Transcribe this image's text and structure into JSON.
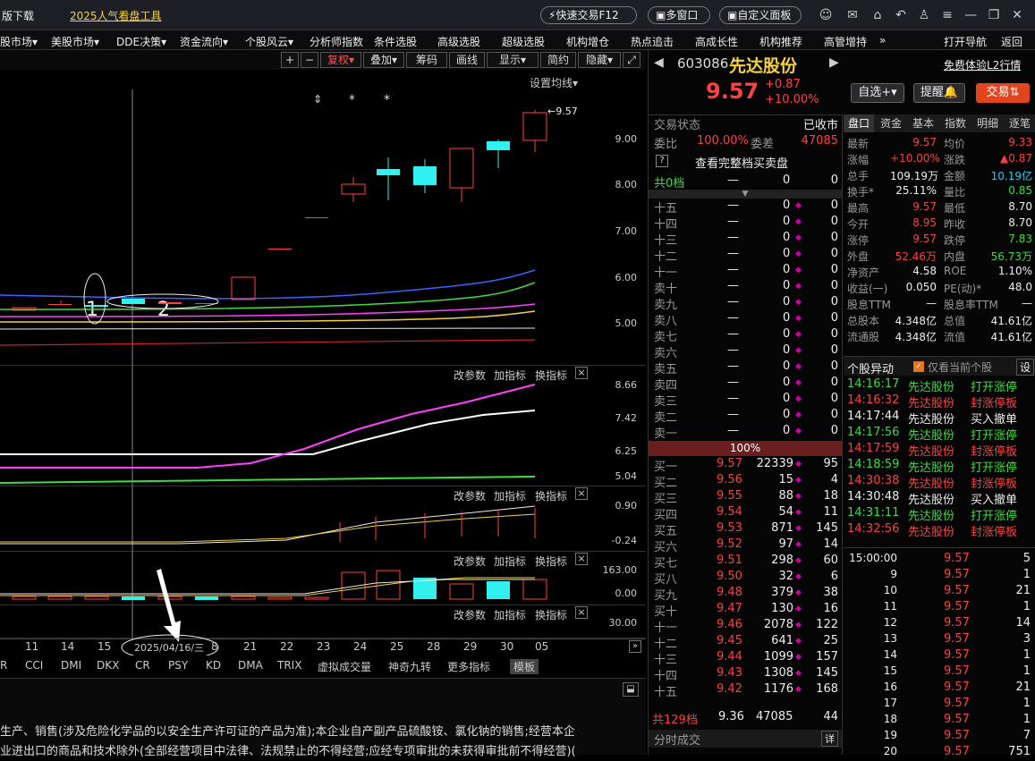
{
  "topbar": {
    "download": "版下载",
    "promo": "2025人气看盘工具",
    "quick_trade": "快速交易F12",
    "multi_window": "多窗口",
    "custom_panel": "自定义面板"
  },
  "menu": [
    "股市场▾",
    "美股市场▾",
    "DDE决策▾",
    "资金流向▾",
    "个股风云▾",
    "分析师指数",
    "条件选股",
    "高级选股",
    "超级选股",
    "机构增仓",
    "热点追击",
    "高成长性",
    "机构推荐",
    "高管增持",
    "»",
    "打开导航",
    "返回"
  ],
  "chart_toolbar": {
    "plus": "+",
    "minus": "−",
    "fuquan": "复权▾",
    "diejia": "叠加▾",
    "chouma": "筹码",
    "huaxian": "画线",
    "xianshi": "显示▾",
    "jianyue": "简约",
    "yincang": "隐藏▾"
  },
  "main_panel": {
    "setting": "设置均线▾",
    "price_label": "9.57",
    "yticks": [
      "9.00",
      "8.00",
      "7.00",
      "6.00",
      "5.00"
    ],
    "annot1": "1",
    "annot2": "2"
  },
  "sub_panels": [
    {
      "ticks": [
        "8.66",
        "7.42",
        "6.25",
        "5.04"
      ]
    },
    {
      "ticks": [
        "0.90",
        "-0.24"
      ]
    },
    {
      "ticks": [
        "163.00",
        "0.00"
      ]
    },
    {
      "ticks": [
        "30.00"
      ]
    }
  ],
  "panel_buttons": {
    "change": "改参数",
    "add": "加指标",
    "switch": "换指标",
    "close": "×"
  },
  "xaxis": {
    "labels": [
      "11",
      "14",
      "15",
      "8",
      "21",
      "22",
      "23",
      "24",
      "25",
      "28",
      "29",
      "30",
      "05"
    ],
    "cursor_date": "2025/04/16/三"
  },
  "indicator_tabs": [
    "R",
    "CCI",
    "DMI",
    "DKX",
    "CR",
    "PSY",
    "KD",
    "DMA",
    "TRIX",
    "虚拟成交量",
    "神奇九转",
    "更多指标",
    "模板"
  ],
  "description": [
    "生产、销售(涉及危险化学品的以安全生产许可证的产品为准);本企业自产副产品硫酸铵、氯化钠的销售;经营本企",
    "业进出口的商品和技术除外(全部经营项目中法律、法规禁止的不得经营;应经专项审批的未获得审批前不得经营)("
  ],
  "stock": {
    "code": "603086",
    "name": "先达股份",
    "price": "9.57",
    "change": "+0.87",
    "pct": "+10.00%",
    "btn_zixuan": "自选+▾",
    "btn_tixing": "提醒",
    "btn_jiaoyi": "交易",
    "l2": "免费体验L2行情"
  },
  "status": {
    "label": "交易状态",
    "value": "已收市",
    "weibi_label": "委比",
    "weibi": "100.00%",
    "weicha_label": "委差",
    "weicha": "47085",
    "view_all": "查看完整档买卖盘",
    "total_label": "共0档",
    "total_dash": "—",
    "total_a": "0",
    "total_b": "0"
  },
  "asks": [
    {
      "l": "十五"
    },
    {
      "l": "十四"
    },
    {
      "l": "十三"
    },
    {
      "l": "十二"
    },
    {
      "l": "十一"
    },
    {
      "l": "卖十"
    },
    {
      "l": "卖九"
    },
    {
      "l": "卖八"
    },
    {
      "l": "卖七"
    },
    {
      "l": "卖六"
    },
    {
      "l": "卖五"
    },
    {
      "l": "卖四"
    },
    {
      "l": "卖三"
    },
    {
      "l": "卖二"
    },
    {
      "l": "卖一"
    }
  ],
  "ask_dash": "—",
  "ask_zero": "0",
  "ratio_bar": "100%",
  "bids": [
    {
      "l": "买一",
      "p": "9.57",
      "v": "22339",
      "c": "95"
    },
    {
      "l": "买二",
      "p": "9.56",
      "v": "15",
      "c": "4"
    },
    {
      "l": "买三",
      "p": "9.55",
      "v": "88",
      "c": "18"
    },
    {
      "l": "买四",
      "p": "9.54",
      "v": "54",
      "c": "11"
    },
    {
      "l": "买五",
      "p": "9.53",
      "v": "871",
      "c": "145"
    },
    {
      "l": "买六",
      "p": "9.52",
      "v": "97",
      "c": "14"
    },
    {
      "l": "买七",
      "p": "9.51",
      "v": "298",
      "c": "60"
    },
    {
      "l": "买八",
      "p": "9.50",
      "v": "32",
      "c": "6"
    },
    {
      "l": "买九",
      "p": "9.48",
      "v": "379",
      "c": "38"
    },
    {
      "l": "买十",
      "p": "9.47",
      "v": "130",
      "c": "16"
    },
    {
      "l": "十一",
      "p": "9.46",
      "v": "2078",
      "c": "122"
    },
    {
      "l": "十二",
      "p": "9.45",
      "v": "641",
      "c": "25"
    },
    {
      "l": "十三",
      "p": "9.44",
      "v": "1099",
      "c": "157"
    },
    {
      "l": "十四",
      "p": "9.43",
      "v": "1308",
      "c": "145"
    },
    {
      "l": "十五",
      "p": "9.42",
      "v": "1176",
      "c": "168"
    }
  ],
  "bid_total": {
    "l": "共129档",
    "p": "9.36",
    "v": "47085",
    "c": "44"
  },
  "tick_header": {
    "l": "分时成交",
    "btn": "详"
  },
  "tabs": [
    "盘口",
    "资金",
    "基本",
    "指数",
    "明细",
    "逐笔"
  ],
  "quote": [
    [
      "最新",
      "9.57",
      "均价",
      "9.33"
    ],
    [
      "涨幅",
      "+10.00%",
      "涨跌",
      "▲0.87"
    ],
    [
      "总手",
      "109.19万",
      "金额",
      "10.19亿"
    ],
    [
      "换手*",
      "25.11%",
      "量比",
      "0.85"
    ],
    [
      "最高",
      "9.57",
      "最低",
      "8.70"
    ],
    [
      "今开",
      "8.95",
      "昨收",
      "8.70"
    ],
    [
      "涨停",
      "9.57",
      "跌停",
      "7.83"
    ],
    [
      "外盘",
      "52.46万",
      "内盘",
      "56.73万"
    ],
    [
      "净资产",
      "4.58",
      "ROE",
      "1.10%"
    ],
    [
      "收益(一)",
      "0.050",
      "PE(动)*",
      "48.0"
    ],
    [
      "股息TTM",
      "—",
      "股息率TTM",
      "—"
    ],
    [
      "总股本",
      "4.348亿",
      "总值",
      "41.61亿"
    ],
    [
      "流通股",
      "4.348亿",
      "流值",
      "41.61亿"
    ]
  ],
  "events_header": {
    "title": "个股异动",
    "check": "仅看当前个股",
    "btn": "设"
  },
  "events": [
    {
      "t": "14:16:17",
      "n": "先达股份",
      "e": "打开涨停",
      "c": "green"
    },
    {
      "t": "14:16:32",
      "n": "先达股份",
      "e": "封涨停板",
      "c": "red"
    },
    {
      "t": "14:17:44",
      "n": "先达股份",
      "e": "买入撤单",
      "c": "white"
    },
    {
      "t": "14:17:56",
      "n": "先达股份",
      "e": "打开涨停",
      "c": "green"
    },
    {
      "t": "14:17:59",
      "n": "先达股份",
      "e": "封涨停板",
      "c": "red"
    },
    {
      "t": "14:18:59",
      "n": "先达股份",
      "e": "打开涨停",
      "c": "green"
    },
    {
      "t": "14:30:38",
      "n": "先达股份",
      "e": "封涨停板",
      "c": "red"
    },
    {
      "t": "14:30:48",
      "n": "先达股份",
      "e": "买入撤单",
      "c": "white"
    },
    {
      "t": "14:31:11",
      "n": "先达股份",
      "e": "打开涨停",
      "c": "green"
    },
    {
      "t": "14:32:56",
      "n": "先达股份",
      "e": "封涨停板",
      "c": "red"
    }
  ],
  "ticks": [
    {
      "t": "15:00:00",
      "p": "9.57",
      "v": "5"
    },
    {
      "t": "9",
      "p": "9.57",
      "v": "1"
    },
    {
      "t": "10",
      "p": "9.57",
      "v": "21"
    },
    {
      "t": "11",
      "p": "9.57",
      "v": "1"
    },
    {
      "t": "12",
      "p": "9.57",
      "v": "14"
    },
    {
      "t": "13",
      "p": "9.57",
      "v": "3"
    },
    {
      "t": "14",
      "p": "9.57",
      "v": "1"
    },
    {
      "t": "15",
      "p": "9.57",
      "v": "1"
    },
    {
      "t": "16",
      "p": "9.57",
      "v": "21"
    },
    {
      "t": "17",
      "p": "9.57",
      "v": "1"
    },
    {
      "t": "18",
      "p": "9.57",
      "v": "1"
    },
    {
      "t": "19",
      "p": "9.57",
      "v": "7"
    },
    {
      "t": "20",
      "p": "9.57",
      "v": "751"
    }
  ],
  "colors": {
    "up": "#ff4040",
    "down": "#31f0f0",
    "ma5": "#ffffff",
    "ma10": "#f5d23b",
    "ma20": "#ff40ff",
    "ma30": "#3fdc3f",
    "ma60": "#4060ff"
  }
}
